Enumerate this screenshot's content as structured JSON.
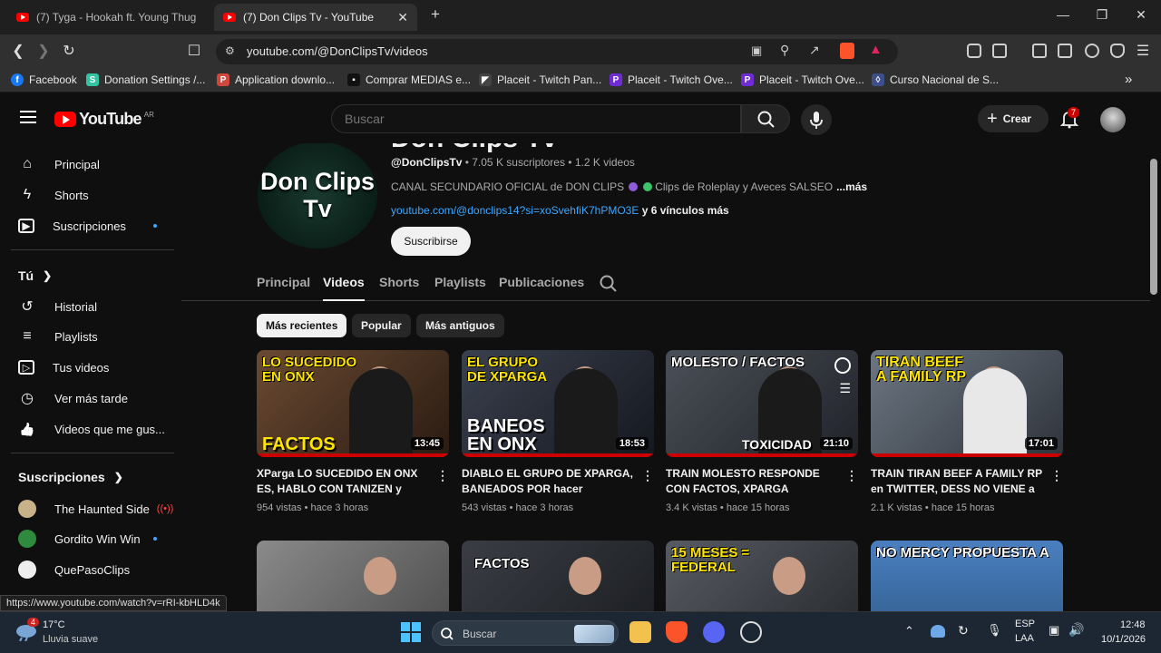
{
  "browser": {
    "tabs": [
      {
        "label": "(7) Tyga - Hookah ft. Young Thug - Yo"
      },
      {
        "label": "(7) Don Clips Tv - YouTube",
        "close": "✕"
      }
    ],
    "new_tab": "+",
    "window_controls": {
      "minimize": "—",
      "maximize": "❐",
      "close": "✕"
    },
    "url": "youtube.com/@DonClipsTv/videos",
    "bookmarks": [
      {
        "label": "Facebook",
        "icon": "facebook-icon",
        "color": "#1877f2",
        "glyph": "f"
      },
      {
        "label": "Donation Settings /...",
        "icon": "streamlabs-icon",
        "color": "#31c3a2",
        "glyph": "S"
      },
      {
        "label": "Application downlo...",
        "icon": "peg-icon",
        "color": "#d0473b",
        "glyph": "P"
      },
      {
        "label": "Comprar MEDIAS e...",
        "icon": "store-icon",
        "color": "#111111",
        "glyph": "▪"
      },
      {
        "label": "Placeit - Twitch Pan...",
        "icon": "placeit-icon",
        "color": "#444444",
        "glyph": "◤"
      },
      {
        "label": "Placeit - Twitch Ove...",
        "icon": "placeit-icon",
        "color": "#6f2bd6",
        "glyph": "P"
      },
      {
        "label": "Placeit - Twitch Ove...",
        "icon": "placeit-icon",
        "color": "#6f2bd6",
        "glyph": "P"
      },
      {
        "label": "Curso Nacional de S...",
        "icon": "course-icon",
        "color": "#3c4f8a",
        "glyph": "◊"
      }
    ],
    "bookmarks_more": "»",
    "status_url": "https://www.youtube.com/watch?v=rRI-kbHLD4k"
  },
  "youtube": {
    "logo_word": "YouTube",
    "region": "AR",
    "search_placeholder": "Buscar",
    "create_label": "Crear",
    "notifications_count": "7"
  },
  "sidebar": {
    "main": [
      {
        "label": "Principal",
        "icon": "home-icon",
        "glyph": "⌂"
      },
      {
        "label": "Shorts",
        "icon": "shorts-icon",
        "glyph": "ϟ"
      },
      {
        "label": "Suscripciones",
        "icon": "subscriptions-icon",
        "glyph": "▶"
      }
    ],
    "you_heading": "Tú",
    "you": [
      {
        "label": "Historial",
        "icon": "history-icon",
        "glyph": "↺"
      },
      {
        "label": "Playlists",
        "icon": "playlists-icon",
        "glyph": "≡"
      },
      {
        "label": "Tus videos",
        "icon": "your-videos-icon",
        "glyph": "▷"
      },
      {
        "label": "Ver más tarde",
        "icon": "watch-later-icon",
        "glyph": "◷"
      },
      {
        "label": "Videos que me gus...",
        "icon": "liked-icon",
        "glyph": "👍"
      }
    ],
    "subs_heading": "Suscripciones",
    "subs": [
      {
        "label": "The Haunted Side",
        "color": "#c8b28a",
        "live": true
      },
      {
        "label": "Gordito Win Win",
        "color": "#2e8b3e",
        "dot": true
      },
      {
        "label": "QuePasoClips",
        "color": "#eeeeee"
      }
    ]
  },
  "channel": {
    "name": "Don Clips Tv",
    "avatar_text": [
      "Don Clips",
      "Tv"
    ],
    "handle": "@DonClipsTv",
    "subscribers": "7.05 K suscriptores",
    "videos_count": "1.2 K videos",
    "description": "CANAL SECUNDARIO OFICIAL de DON CLIPS",
    "description_tail": "Clips de Roleplay y Aveces SALSEO",
    "more": "...más",
    "link": "youtube.com/@donclips14?si=xoSvehfiK7hPMO3E",
    "links_more": "y 6 vínculos más",
    "subscribe_label": "Suscribirse",
    "tabs": [
      "Principal",
      "Videos",
      "Shorts",
      "Playlists",
      "Publicaciones"
    ],
    "active_tab": "Videos",
    "chips": [
      "Más recientes",
      "Popular",
      "Más antiguos"
    ],
    "selected_chip": "Más recientes"
  },
  "videos": [
    {
      "title": "XParga LO SUCEDIDO EN ONX ES, HABLO CON TANIZEN y TRAIN,...",
      "views": "954 vistas",
      "age": "hace 3 horas",
      "duration": "13:45",
      "thumb_top": "LO SUCEDIDO EN ONX",
      "thumb_bottom": "FACTOS",
      "bg": "#5a3a26"
    },
    {
      "title": "DIABLO EL GRUPO DE XPARGA, BANEADOS POR hacer CALVADAS...",
      "views": "543 vistas",
      "age": "hace 3 horas",
      "duration": "18:53",
      "thumb_top": "EL GRUPO DE XPARGA",
      "thumb_bottom": "BANEOS EN ONX",
      "bg": "#2a2f3a"
    },
    {
      "title": "TRAIN MOLESTO RESPONDE CON FACTOS, XPARGA SINCHYBOYZ...",
      "views": "3.4 K vistas",
      "age": "hace 15 horas",
      "duration": "21:10",
      "thumb_top": "MOLESTO / FACTOS",
      "thumb_bottom": "TOXICIDAD",
      "bg": "#3a3f47"
    },
    {
      "title": "TRAIN TIRAN BEEF A FAMILY RP en TWITTER, DESS NO VIENE a FAMIL...",
      "views": "2.1 K vistas",
      "age": "hace 15 horas",
      "duration": "17:01",
      "thumb_top": "TIRAN BEEF A FAMILY RP",
      "thumb_bottom": "",
      "bg": "#5a6470"
    },
    {
      "title": "",
      "views": "",
      "age": "",
      "duration": "",
      "thumb_top": "",
      "thumb_bottom": "",
      "bg": "#6c6c6c"
    },
    {
      "title": "",
      "views": "",
      "age": "",
      "duration": "",
      "thumb_top": "FACTOS",
      "thumb_bottom": "",
      "bg": "#33363c"
    },
    {
      "title": "",
      "views": "",
      "age": "",
      "duration": "",
      "thumb_top": "15 MESES = FEDERAL",
      "thumb_bottom": "",
      "bg": "#474b52"
    },
    {
      "title": "",
      "views": "",
      "age": "",
      "duration": "",
      "thumb_top": "NO MERCY PROPUESTA A",
      "thumb_bottom": "",
      "bg": "#3f6fa8"
    }
  ],
  "taskbar": {
    "weather_temp": "17°C",
    "weather_desc": "Lluvia suave",
    "weather_badge": "4",
    "search_placeholder": "Buscar",
    "lang_line1": "ESP",
    "lang_line2": "LAA",
    "time": "12:48",
    "date": "10/1/2026"
  },
  "colors": {
    "accent_red": "#ff0000",
    "link_blue": "#3ea6ff",
    "thumb_yellow": "#ffe600"
  }
}
